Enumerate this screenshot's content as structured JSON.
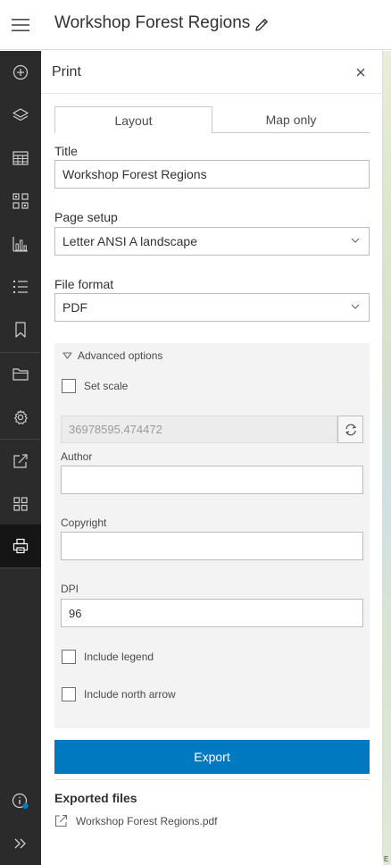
{
  "header": {
    "menu_icon": "hamburger-menu-icon",
    "title": "Workshop Forest Regions",
    "edit_icon": "pencil-icon"
  },
  "actionbar": {
    "items": [
      {
        "name": "add-data",
        "icon": "plus-circle-icon"
      },
      {
        "name": "layers",
        "icon": "layers-icon"
      },
      {
        "name": "tables",
        "icon": "table-icon"
      },
      {
        "name": "legend",
        "icon": "legend-icon"
      },
      {
        "name": "charts",
        "icon": "bar-chart-icon"
      },
      {
        "name": "sketch",
        "icon": "list-icon"
      },
      {
        "name": "bookmarks",
        "icon": "bookmark-icon"
      },
      {
        "name": "properties",
        "icon": "folder-icon"
      },
      {
        "name": "configure",
        "icon": "gear-icon"
      },
      {
        "name": "share",
        "icon": "share-icon"
      },
      {
        "name": "apps",
        "icon": "grid-icon"
      },
      {
        "name": "print",
        "icon": "printer-icon",
        "active": true
      }
    ],
    "bottom": [
      {
        "name": "about",
        "icon": "info-icon"
      },
      {
        "name": "expand",
        "icon": "double-chevron-right-icon"
      }
    ],
    "active_color": "#151515",
    "background": "#2b2b2b",
    "notification_dot_color": "#0079c1"
  },
  "panel": {
    "title": "Print",
    "close_icon": "close-icon",
    "tabs": [
      {
        "label": "Layout",
        "active": true
      },
      {
        "label": "Map only",
        "active": false
      }
    ],
    "title_label": "Title",
    "title_value": "Workshop Forest Regions",
    "page_setup_label": "Page setup",
    "page_setup_value": "Letter ANSI A landscape",
    "file_format_label": "File format",
    "file_format_value": "PDF",
    "advanced": {
      "toggle_label": "Advanced options",
      "set_scale_label": "Set scale",
      "scale_value": "36978595.474472",
      "author_label": "Author",
      "author_value": "",
      "copyright_label": "Copyright",
      "copyright_value": "",
      "dpi_label": "DPI",
      "dpi_value": "96",
      "include_legend_label": "Include legend",
      "include_north_arrow_label": "Include north arrow"
    },
    "export_label": "Export",
    "export_color": "#0079c1",
    "exported_files_title": "Exported files",
    "exported_files": [
      {
        "name": "Workshop Forest Regions.pdf",
        "icon": "external-link-icon"
      }
    ]
  },
  "map": {
    "attribution": "E"
  }
}
